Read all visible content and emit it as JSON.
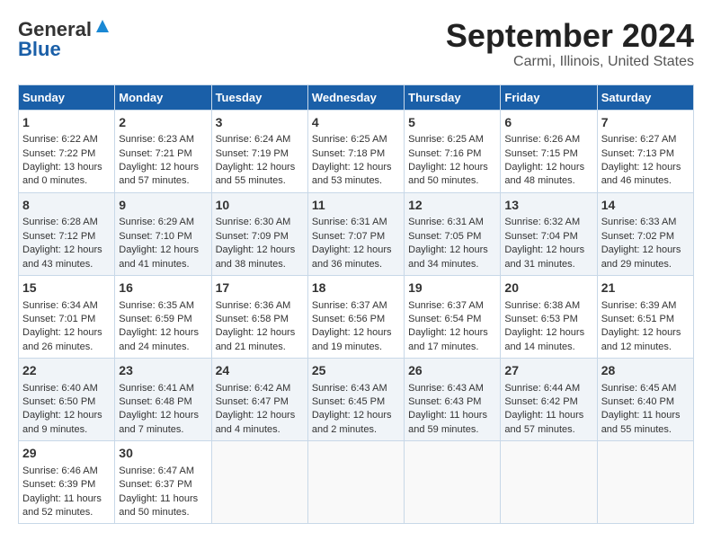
{
  "header": {
    "logo_line1": "General",
    "logo_line2": "Blue",
    "title": "September 2024",
    "subtitle": "Carmi, Illinois, United States"
  },
  "weekdays": [
    "Sunday",
    "Monday",
    "Tuesday",
    "Wednesday",
    "Thursday",
    "Friday",
    "Saturday"
  ],
  "weeks": [
    [
      {
        "day": "1",
        "sunrise": "6:22 AM",
        "sunset": "7:22 PM",
        "daylight": "13 hours and 0 minutes."
      },
      {
        "day": "2",
        "sunrise": "6:23 AM",
        "sunset": "7:21 PM",
        "daylight": "12 hours and 57 minutes."
      },
      {
        "day": "3",
        "sunrise": "6:24 AM",
        "sunset": "7:19 PM",
        "daylight": "12 hours and 55 minutes."
      },
      {
        "day": "4",
        "sunrise": "6:25 AM",
        "sunset": "7:18 PM",
        "daylight": "12 hours and 53 minutes."
      },
      {
        "day": "5",
        "sunrise": "6:25 AM",
        "sunset": "7:16 PM",
        "daylight": "12 hours and 50 minutes."
      },
      {
        "day": "6",
        "sunrise": "6:26 AM",
        "sunset": "7:15 PM",
        "daylight": "12 hours and 48 minutes."
      },
      {
        "day": "7",
        "sunrise": "6:27 AM",
        "sunset": "7:13 PM",
        "daylight": "12 hours and 46 minutes."
      }
    ],
    [
      {
        "day": "8",
        "sunrise": "6:28 AM",
        "sunset": "7:12 PM",
        "daylight": "12 hours and 43 minutes."
      },
      {
        "day": "9",
        "sunrise": "6:29 AM",
        "sunset": "7:10 PM",
        "daylight": "12 hours and 41 minutes."
      },
      {
        "day": "10",
        "sunrise": "6:30 AM",
        "sunset": "7:09 PM",
        "daylight": "12 hours and 38 minutes."
      },
      {
        "day": "11",
        "sunrise": "6:31 AM",
        "sunset": "7:07 PM",
        "daylight": "12 hours and 36 minutes."
      },
      {
        "day": "12",
        "sunrise": "6:31 AM",
        "sunset": "7:05 PM",
        "daylight": "12 hours and 34 minutes."
      },
      {
        "day": "13",
        "sunrise": "6:32 AM",
        "sunset": "7:04 PM",
        "daylight": "12 hours and 31 minutes."
      },
      {
        "day": "14",
        "sunrise": "6:33 AM",
        "sunset": "7:02 PM",
        "daylight": "12 hours and 29 minutes."
      }
    ],
    [
      {
        "day": "15",
        "sunrise": "6:34 AM",
        "sunset": "7:01 PM",
        "daylight": "12 hours and 26 minutes."
      },
      {
        "day": "16",
        "sunrise": "6:35 AM",
        "sunset": "6:59 PM",
        "daylight": "12 hours and 24 minutes."
      },
      {
        "day": "17",
        "sunrise": "6:36 AM",
        "sunset": "6:58 PM",
        "daylight": "12 hours and 21 minutes."
      },
      {
        "day": "18",
        "sunrise": "6:37 AM",
        "sunset": "6:56 PM",
        "daylight": "12 hours and 19 minutes."
      },
      {
        "day": "19",
        "sunrise": "6:37 AM",
        "sunset": "6:54 PM",
        "daylight": "12 hours and 17 minutes."
      },
      {
        "day": "20",
        "sunrise": "6:38 AM",
        "sunset": "6:53 PM",
        "daylight": "12 hours and 14 minutes."
      },
      {
        "day": "21",
        "sunrise": "6:39 AM",
        "sunset": "6:51 PM",
        "daylight": "12 hours and 12 minutes."
      }
    ],
    [
      {
        "day": "22",
        "sunrise": "6:40 AM",
        "sunset": "6:50 PM",
        "daylight": "12 hours and 9 minutes."
      },
      {
        "day": "23",
        "sunrise": "6:41 AM",
        "sunset": "6:48 PM",
        "daylight": "12 hours and 7 minutes."
      },
      {
        "day": "24",
        "sunrise": "6:42 AM",
        "sunset": "6:47 PM",
        "daylight": "12 hours and 4 minutes."
      },
      {
        "day": "25",
        "sunrise": "6:43 AM",
        "sunset": "6:45 PM",
        "daylight": "12 hours and 2 minutes."
      },
      {
        "day": "26",
        "sunrise": "6:43 AM",
        "sunset": "6:43 PM",
        "daylight": "11 hours and 59 minutes."
      },
      {
        "day": "27",
        "sunrise": "6:44 AM",
        "sunset": "6:42 PM",
        "daylight": "11 hours and 57 minutes."
      },
      {
        "day": "28",
        "sunrise": "6:45 AM",
        "sunset": "6:40 PM",
        "daylight": "11 hours and 55 minutes."
      }
    ],
    [
      {
        "day": "29",
        "sunrise": "6:46 AM",
        "sunset": "6:39 PM",
        "daylight": "11 hours and 52 minutes."
      },
      {
        "day": "30",
        "sunrise": "6:47 AM",
        "sunset": "6:37 PM",
        "daylight": "11 hours and 50 minutes."
      },
      null,
      null,
      null,
      null,
      null
    ]
  ],
  "labels": {
    "sunrise": "Sunrise:",
    "sunset": "Sunset:",
    "daylight": "Daylight:"
  }
}
